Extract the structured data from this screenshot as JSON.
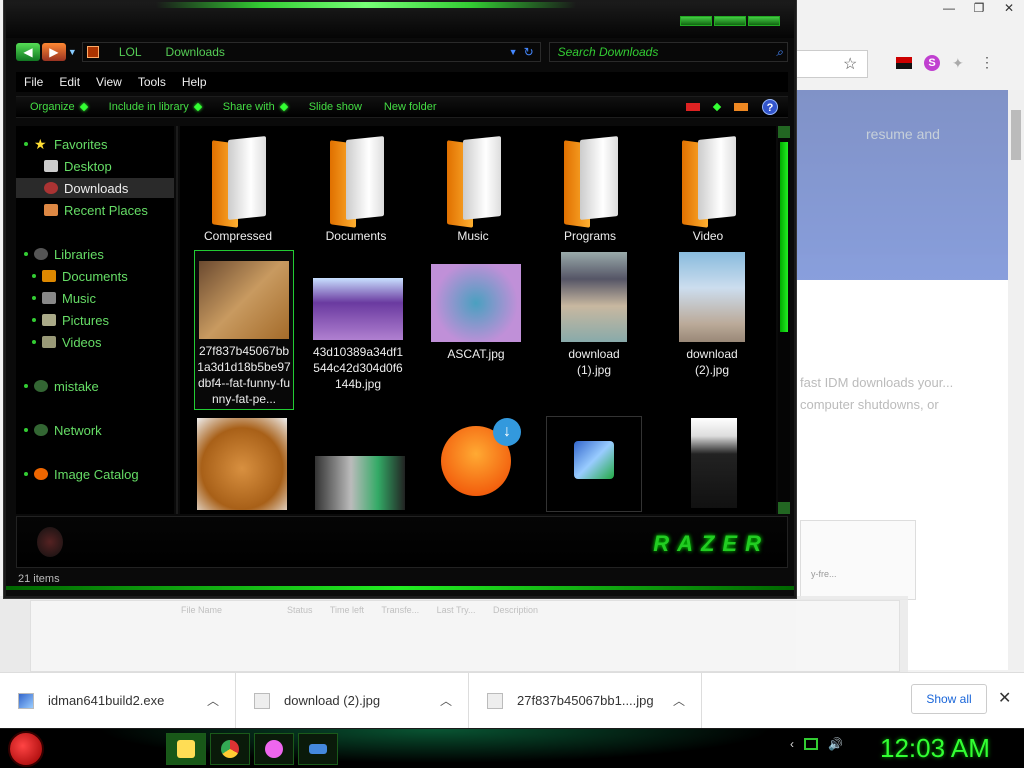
{
  "browser": {
    "window_controls": [
      "—",
      "❐",
      "✕"
    ],
    "banner_text": "resume and",
    "body_text": "fast IDM downloads your... computer shutdowns, or",
    "box_text": "y-fre...",
    "blur_header": [
      "File Name",
      "Status",
      "Time left",
      "Transfe...",
      "Last Try...",
      "Description"
    ]
  },
  "explorer": {
    "address": {
      "root": "LOL",
      "folder": "Downloads"
    },
    "search_placeholder": "Search Downloads",
    "menu": [
      "File",
      "Edit",
      "View",
      "Tools",
      "Help"
    ],
    "commands": [
      "Organize",
      "Include in library",
      "Share with",
      "Slide show",
      "New folder"
    ],
    "sidebar": {
      "favorites": "Favorites",
      "desktop": "Desktop",
      "downloads": "Downloads",
      "recent": "Recent Places",
      "libraries": "Libraries",
      "documents": "Documents",
      "music": "Music",
      "pictures": "Pictures",
      "videos": "Videos",
      "mistake": "mistake",
      "network": "Network",
      "image_catalog": "Image Catalog"
    },
    "items": {
      "compressed": "Compressed",
      "documents": "Documents",
      "music": "Music",
      "programs": "Programs",
      "video": "Video",
      "file1": "27f837b45067bb1a3d1d18b5be97dbf4--fat-funny-funny-fat-pe...",
      "file2": "43d10389a34df1544c42d304d0f6144b.jpg",
      "file3": "ASCAT.jpg",
      "file4": "download (1).jpg",
      "file5": "download (2).jpg"
    },
    "razer_logo": "RAZER",
    "status": "21 items"
  },
  "downloads": {
    "items": [
      {
        "name": "idman641build2.exe"
      },
      {
        "name": "download (2).jpg"
      },
      {
        "name": "27f837b45067bb1....jpg"
      }
    ],
    "show_all": "Show all"
  },
  "taskbar": {
    "clock": "12:03 AM"
  }
}
